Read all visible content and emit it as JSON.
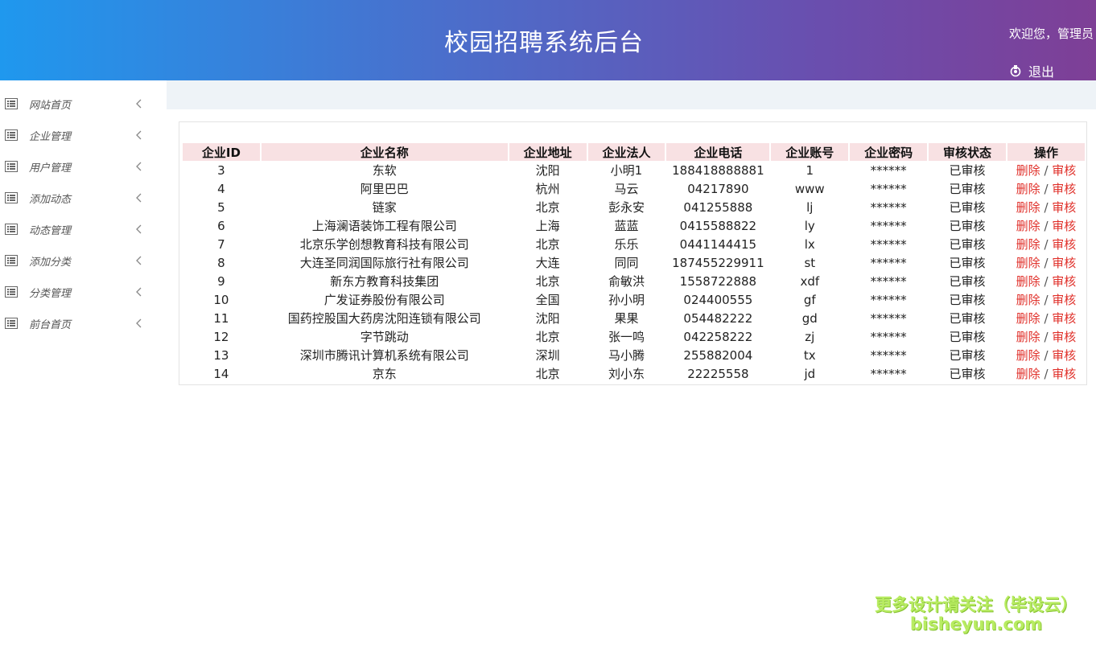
{
  "header": {
    "title": "校园招聘系统后台",
    "welcome": "欢迎您，管理员",
    "logout_label": "退出"
  },
  "sidebar": {
    "items": [
      {
        "label": "网站首页"
      },
      {
        "label": "企业管理"
      },
      {
        "label": "用户管理"
      },
      {
        "label": "添加动态"
      },
      {
        "label": "动态管理"
      },
      {
        "label": "添加分类"
      },
      {
        "label": "分类管理"
      },
      {
        "label": "前台首页"
      }
    ]
  },
  "table": {
    "columns": [
      "企业ID",
      "企业名称",
      "企业地址",
      "企业法人",
      "企业电话",
      "企业账号",
      "企业密码",
      "审核状态",
      "操作"
    ],
    "rows": [
      {
        "id": "3",
        "name": "东软",
        "addr": "沈阳",
        "legal": "小明1",
        "phone": "188418888881",
        "account": "1",
        "password": "******",
        "status": "已审核"
      },
      {
        "id": "4",
        "name": "阿里巴巴",
        "addr": "杭州",
        "legal": "马云",
        "phone": "04217890",
        "account": "www",
        "password": "******",
        "status": "已审核"
      },
      {
        "id": "5",
        "name": "链家",
        "addr": "北京",
        "legal": "彭永安",
        "phone": "041255888",
        "account": "lj",
        "password": "******",
        "status": "已审核"
      },
      {
        "id": "6",
        "name": "上海澜语装饰工程有限公司",
        "addr": "上海",
        "legal": "蓝蓝",
        "phone": "0415588822",
        "account": "ly",
        "password": "******",
        "status": "已审核"
      },
      {
        "id": "7",
        "name": "北京乐学创想教育科技有限公司",
        "addr": "北京",
        "legal": "乐乐",
        "phone": "0441144415",
        "account": "lx",
        "password": "******",
        "status": "已审核"
      },
      {
        "id": "8",
        "name": "大连圣同润国际旅行社有限公司",
        "addr": "大连",
        "legal": "同同",
        "phone": "187455229911",
        "account": "st",
        "password": "******",
        "status": "已审核"
      },
      {
        "id": "9",
        "name": "新东方教育科技集团",
        "addr": "北京",
        "legal": "俞敏洪",
        "phone": "1558722888",
        "account": "xdf",
        "password": "******",
        "status": "已审核"
      },
      {
        "id": "10",
        "name": "广发证券股份有限公司",
        "addr": "全国",
        "legal": "孙小明",
        "phone": "024400555",
        "account": "gf",
        "password": "******",
        "status": "已审核"
      },
      {
        "id": "11",
        "name": "国药控股国大药房沈阳连锁有限公司",
        "addr": "沈阳",
        "legal": "果果",
        "phone": "054482222",
        "account": "gd",
        "password": "******",
        "status": "已审核"
      },
      {
        "id": "12",
        "name": "字节跳动",
        "addr": "北京",
        "legal": "张一鸣",
        "phone": "042258222",
        "account": "zj",
        "password": "******",
        "status": "已审核"
      },
      {
        "id": "13",
        "name": "深圳市腾讯计算机系统有限公司",
        "addr": "深圳",
        "legal": "马小腾",
        "phone": "255882004",
        "account": "tx",
        "password": "******",
        "status": "已审核"
      },
      {
        "id": "14",
        "name": "京东",
        "addr": "北京",
        "legal": "刘小东",
        "phone": "22225558",
        "account": "jd",
        "password": "******",
        "status": "已审核"
      }
    ],
    "action_delete": "删除",
    "action_separator": "/",
    "action_review": "审核"
  },
  "watermark": {
    "line1": "更多设计请关注（毕设云）",
    "line2": "bisheyun.com"
  },
  "colors": {
    "header_gradient_start": "#1f98ee",
    "header_gradient_end": "#7e3f96",
    "table_header_bg": "#f8e1e3",
    "action_link": "#e0302a",
    "top_band": "#eef3f7",
    "watermark": "#b8ec62"
  },
  "icons": {
    "sidebar_item": "list-icon",
    "sidebar_expand": "chevron-left-icon",
    "logout": "power-icon"
  }
}
